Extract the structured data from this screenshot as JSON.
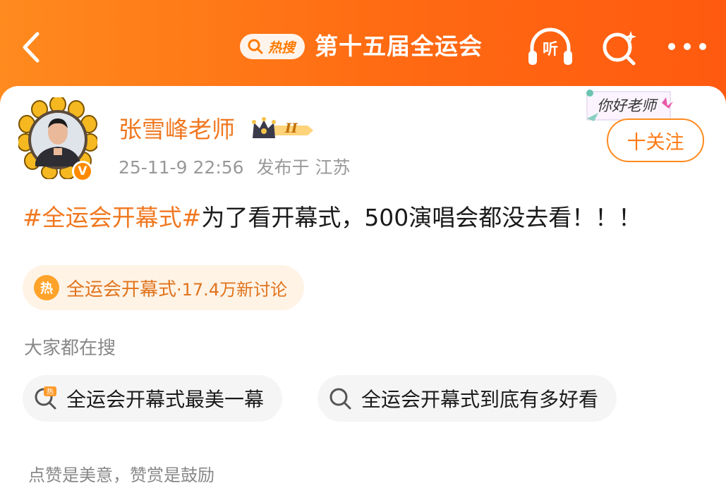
{
  "header": {
    "hot_tag": "热搜",
    "topic_title": "第十五届全运会",
    "listen_label": "听"
  },
  "post": {
    "author": "张雪峰老师",
    "level_badge": "II",
    "time": "25-11-9 22:56",
    "location": "发布于 江苏",
    "sticker_text": "你好老师",
    "follow_label": "十关注",
    "hashtag": "#全运会开幕式#",
    "text": "为了看开幕式，500演唱会都没去看！！！"
  },
  "topic_pill": {
    "icon_text": "热",
    "name": "全运会开幕式",
    "count": "·17.4万新讨论"
  },
  "related_search": {
    "label": "大家都在搜",
    "chips": [
      {
        "text": "全运会开幕式最美一幕",
        "icon": "hot-search-icon"
      },
      {
        "text": "全运会开幕式到底有多好看",
        "icon": "search-icon"
      }
    ]
  },
  "footer": {
    "note": "点赞是美意，赞赏是鼓励"
  },
  "colors": {
    "brand_orange": "#ff6a12",
    "hashtag_orange": "#f07820",
    "pill_bg": "#fff3e6"
  }
}
